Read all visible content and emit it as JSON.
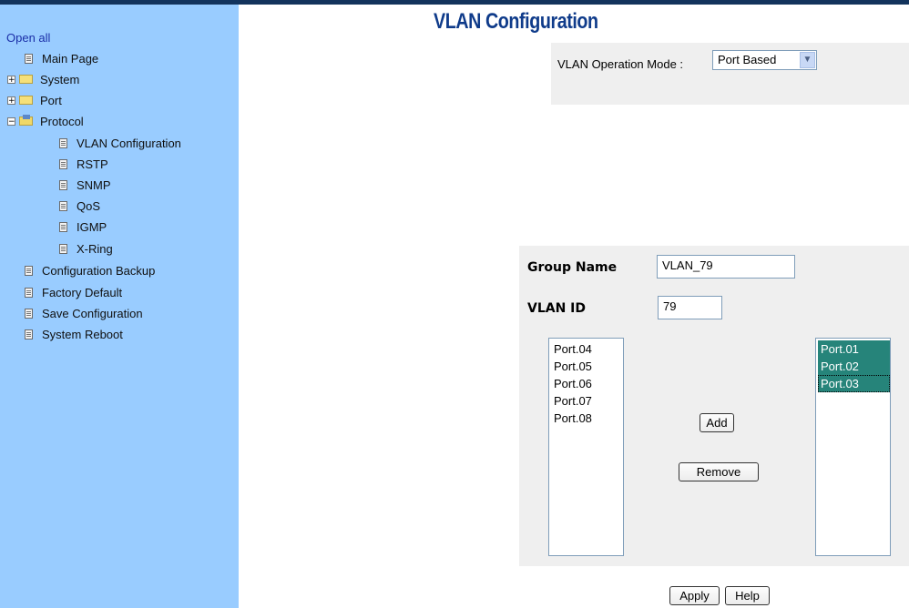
{
  "sidebar": {
    "open_all": "Open all",
    "items": [
      {
        "label": "Main Page"
      },
      {
        "label": "System"
      },
      {
        "label": "Port"
      },
      {
        "label": "Protocol"
      },
      {
        "label": "VLAN Configuration"
      },
      {
        "label": "RSTP"
      },
      {
        "label": "SNMP"
      },
      {
        "label": "QoS"
      },
      {
        "label": "IGMP"
      },
      {
        "label": "X-Ring"
      },
      {
        "label": "Configuration Backup"
      },
      {
        "label": "Factory Default"
      },
      {
        "label": "Save Configuration"
      },
      {
        "label": "System Reboot"
      }
    ]
  },
  "main": {
    "title": "VLAN Configuration",
    "mode_label": "VLAN Operation Mode :",
    "mode_value": "Port Based",
    "group_name_label": "Group Name",
    "group_name_value": "VLAN_79",
    "vlan_id_label": "VLAN ID",
    "vlan_id_value": "79",
    "available_ports": [
      "Port.04",
      "Port.05",
      "Port.06",
      "Port.07",
      "Port.08"
    ],
    "member_ports": [
      "Port.01",
      "Port.02",
      "Port.03"
    ],
    "add_label": "Add",
    "remove_label": "Remove",
    "apply_label": "Apply",
    "help_label": "Help"
  },
  "colors": {
    "sidebar_bg": "#99ccff",
    "title": "#0f3b8a",
    "selected_item": "#26847a",
    "panel_bg": "#efefef"
  }
}
